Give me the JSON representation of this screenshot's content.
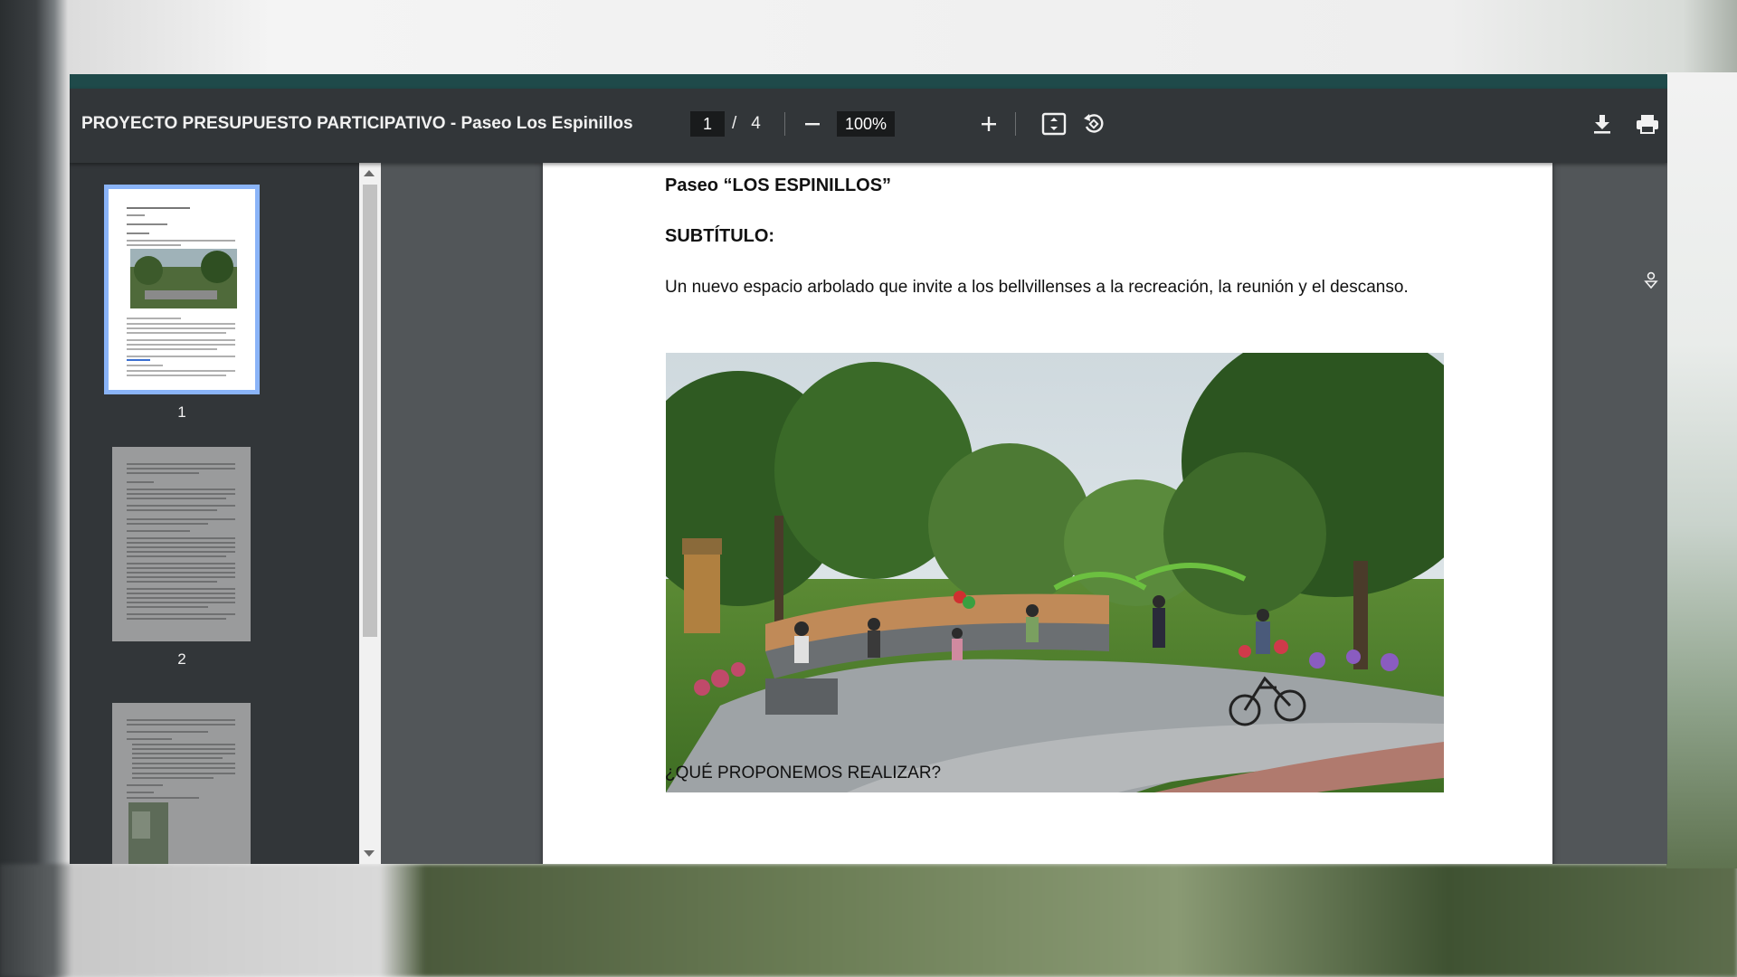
{
  "viewer": {
    "title": "PROYECTO PRESUPUESTO PARTICIPATIVO - Paseo Los Espinillos",
    "current_page": "1",
    "page_separator": "/",
    "total_pages": "4",
    "zoom": "100%",
    "icons": {
      "zoom_out": "minus-icon",
      "zoom_in": "plus-icon",
      "fit": "fit-page-icon",
      "rotate": "rotate-icon",
      "download": "download-icon",
      "print": "print-icon"
    }
  },
  "thumbnails": [
    {
      "label": "1",
      "selected": true
    },
    {
      "label": "2",
      "selected": false
    }
  ],
  "document": {
    "title": "Paseo “LOS ESPINILLOS”",
    "subtitle_heading": "SUBTÍTULO:",
    "subtitle_text": "Un nuevo espacio arbolado que invite a los bellvillenses  a la recreación, la reunión y el descanso.",
    "section_heading": "¿QUÉ PROPONEMOS REALIZAR?"
  },
  "colors": {
    "toolbar": "#323639",
    "canvas": "#525659",
    "selected_thumb": "#8ab4f8"
  }
}
